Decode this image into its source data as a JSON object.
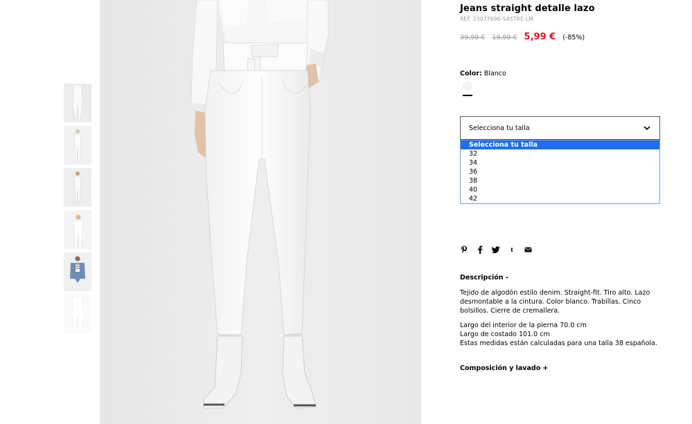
{
  "product": {
    "title": "Jeans straight detalle lazo",
    "ref": "REF. 23077696-SASTRE-LM",
    "prices": {
      "original": "39,99 €",
      "previous": "19,99 €",
      "current": "5,99 €",
      "discount": "(-85%)"
    },
    "color": {
      "label": "Color:",
      "value": "Blanco",
      "swatch_hex": "#f3f3f3"
    },
    "size_select": {
      "selected": "Selecciona tu talla",
      "options": [
        "Selecciona tu talla",
        "32",
        "34",
        "36",
        "38",
        "40",
        "42"
      ]
    },
    "share_icons": [
      "pinterest-icon",
      "facebook-icon",
      "twitter-icon",
      "tumblr-icon",
      "email-icon"
    ],
    "description": {
      "heading": "Descripción -",
      "text": "Tejido de algodón estilo denim. Straight-fit. Tiro alto. Lazo desmontable a la cintura. Color blanco. Trabillas. Cinco bolsillos. Cierre de cremallera.",
      "measures": [
        "Largo del interior de la pierna 70.0 cm",
        "Largo de costado 101.0 cm",
        "Estas medidas están calculadas para una talla 38 española."
      ]
    },
    "composition_heading": "Composición y lavado +"
  },
  "colors": {
    "sale_red": "#e0102d",
    "select_highlight": "#1e6ff0",
    "muted_text": "#9a9a9a"
  }
}
